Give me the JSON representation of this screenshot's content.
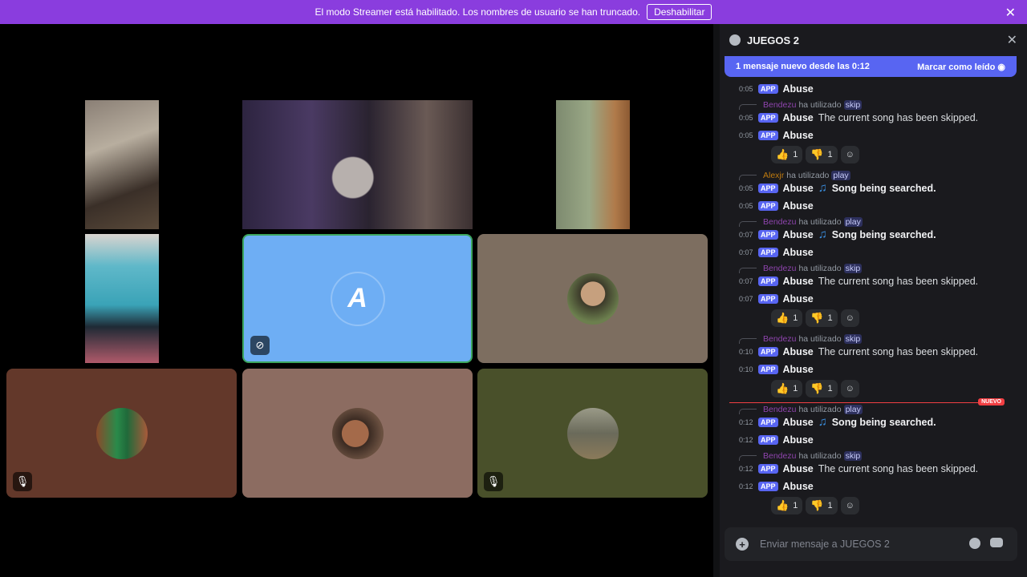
{
  "banner": {
    "text": "El modo Streamer está habilitado. Los nombres de usuario se han truncado.",
    "button": "Deshabilitar"
  },
  "panel": {
    "title": "JUEGOS 2",
    "new_messages": "1 mensaje nuevo desde las 0:12",
    "mark_read": "Marcar como leído",
    "composer_placeholder": "Enviar mensaje a JUEGOS 2",
    "new_badge": "NUEVO"
  },
  "tiles": {
    "avatar_letter": "A"
  },
  "colors": {
    "accent": "#5865f2",
    "banner": "#8a3dde",
    "speaking": "#3ba55d",
    "new": "#f23f43"
  },
  "messages": {
    "bot": "Abuse",
    "app": "APP",
    "used": "ha utilizado",
    "users": [
      "Bendezu",
      "Alexjr",
      "Bendezu",
      "Bendezu",
      "Bendezu",
      "Bendezu",
      "Bendezu"
    ],
    "cmds": [
      "skip",
      "play",
      "play",
      "skip",
      "skip",
      "play",
      "skip"
    ],
    "skipped": "The current song has been skipped.",
    "searching": "Song being searched.",
    "times": [
      "0:05",
      "0:05",
      "0:05",
      "0:05",
      "0:05",
      "0:07",
      "0:07",
      "0:07",
      "0:07",
      "0:10",
      "0:10",
      "0:12",
      "0:12",
      "0:12",
      "0:12"
    ],
    "reactions": {
      "up": "1",
      "down": "1"
    }
  }
}
